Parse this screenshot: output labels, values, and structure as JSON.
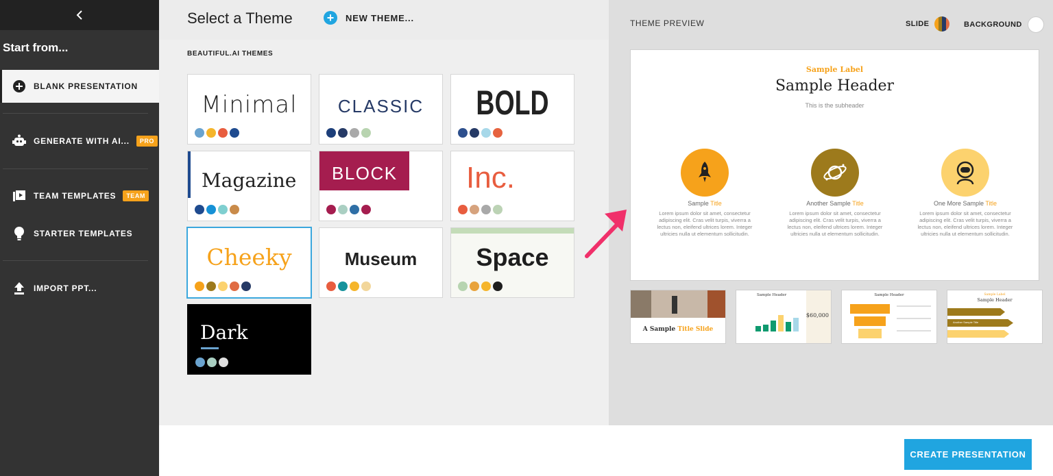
{
  "sidebar": {
    "start_from": "Start from...",
    "items": [
      {
        "label": "BLANK PRESENTATION",
        "icon": "plus-circle-icon"
      },
      {
        "label": "GENERATE WITH AI...",
        "icon": "robot-icon",
        "badge": "PRO"
      },
      {
        "label": "TEAM TEMPLATES",
        "icon": "play-stack-icon",
        "badge": "TEAM"
      },
      {
        "label": "STARTER TEMPLATES",
        "icon": "lightbulb-icon"
      },
      {
        "label": "IMPORT PPT...",
        "icon": "upload-icon"
      }
    ]
  },
  "header": {
    "title": "Select a Theme",
    "new_theme": "NEW THEME..."
  },
  "themes_label": "BEAUTIFUL.AI THEMES",
  "themes": [
    {
      "name": "Minimal",
      "colors": [
        "#6aa3cf",
        "#f5b52b",
        "#e85d3f",
        "#1f4b8f"
      ]
    },
    {
      "name": "CLASSIC",
      "colors": [
        "#1d3f7a",
        "#263a66",
        "#a9a9a9",
        "#b8d4b0"
      ]
    },
    {
      "name": "BOLD",
      "colors": [
        "#2d4f8d",
        "#263a66",
        "#a7d8e9",
        "#e6633f"
      ]
    },
    {
      "name": "Magazine",
      "colors": [
        "#1f4b8f",
        "#1691d6",
        "#7fcfd0",
        "#c98b4a"
      ]
    },
    {
      "name": "BLOCK",
      "colors": [
        "#a51d4f",
        "#aacfc2",
        "#2f6fa6",
        "#a51d4f"
      ]
    },
    {
      "name": "Inc.",
      "colors": [
        "#e85d3f",
        "#d6a37e",
        "#a9a9a9",
        "#bcd3b5"
      ]
    },
    {
      "name": "Cheeky",
      "colors": [
        "#f6a21b",
        "#9d7a1c",
        "#fcd26e",
        "#e06c44",
        "#263a66"
      ]
    },
    {
      "name": "Museum",
      "colors": [
        "#e85d3f",
        "#16929b",
        "#f5b52b",
        "#f2d69a"
      ]
    },
    {
      "name": "Space",
      "colors": [
        "#b7d4b0",
        "#e8a33c",
        "#f5b52b",
        "#1e1e1e"
      ]
    },
    {
      "name": "Dark",
      "colors": [
        "#6aa3cf",
        "#a9cfc2",
        "#e0e0e0"
      ]
    }
  ],
  "preview": {
    "label": "THEME PREVIEW",
    "slide_label": "SLIDE",
    "background_label": "BACKGROUND",
    "slide_colors": [
      "#f6a21b",
      "#9d7a1c",
      "#263a66"
    ],
    "sample_label": "Sample Label",
    "sample_header": "Sample Header",
    "sample_sub": "This is the subheader",
    "features": [
      {
        "title_prefix": "Sample ",
        "title_accent": "Title",
        "icon": "rocket-icon",
        "color": "#f6a21b",
        "text": "Lorem ipsum dolor sit amet, consectetur adipiscing elit. Cras velit turpis, viverra a lectus non, eleifend ultrices lorem. Integer ultricies nulla ut elementum sollicitudin."
      },
      {
        "title_prefix": "Another Sample ",
        "title_accent": "Title",
        "icon": "planet-icon",
        "color": "#9d7a1c",
        "text": "Lorem ipsum dolor sit amet, consectetur adipiscing elit. Cras velit turpis, viverra a lectus non, eleifend ultrices lorem. Integer ultricies nulla ut elementum sollicitudin."
      },
      {
        "title_prefix": "One More Sample ",
        "title_accent": "Title",
        "icon": "astronaut-icon",
        "color": "#fcd26e",
        "text": "Lorem ipsum dolor sit amet, consectetur adipiscing elit. Cras velit turpis, viverra a lectus non, eleifend ultrices lorem. Integer ultricies nulla ut elementum sollicitudin."
      }
    ],
    "thumbs": {
      "t1_title_a": "A Sample ",
      "t1_title_b": "Title Slide",
      "t2_header": "Sample Header",
      "t2_value": "$60,000",
      "t3_header": "Sample Header",
      "t4_label": "Sample Label",
      "t4_header": "Sample Header",
      "t4_item": "Another Sample Title"
    }
  },
  "footer": {
    "create_button": "CREATE PRESENTATION"
  }
}
